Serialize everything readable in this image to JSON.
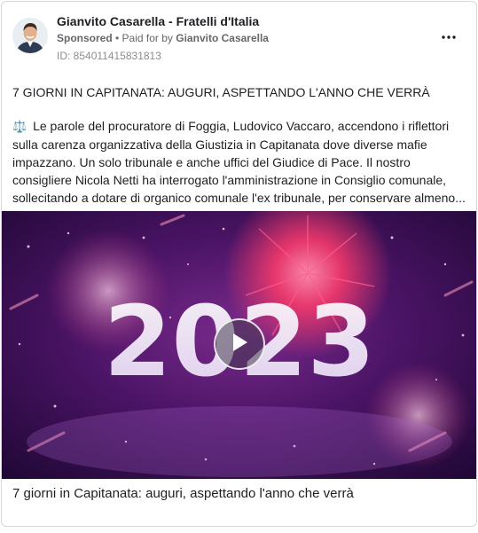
{
  "post": {
    "page_name": "Gianvito Casarella - Fratelli d'Italia",
    "sponsored_label": "Sponsored",
    "paid_for_prefix": "• Paid for by",
    "paid_for_name": "Gianvito Casarella",
    "ad_id": "ID: 854011415831813",
    "headline": "7 GIORNI IN CAPITANATA: AUGURI, ASPETTANDO L'ANNO CHE VERRÀ",
    "body_emoji": "⚖️",
    "body": "Le parole del procuratore di Foggia, Ludovico Vaccaro, accendono i riflettori sulla carenza organizzativa della Giustizia in Capitanata dove diverse mafie impazzano. Un solo tribunale e anche uffici del Giudice di Pace. Il nostro consigliere Nicola Netti ha interrogato l'amministrazione in Consiglio comunale, sollecitando a dotare di organico comunale l'ex tribunale, per conservare almeno...",
    "media_year": "2023",
    "caption": "7 giorni in Capitanata: auguri, aspettando l'anno che verrà"
  },
  "icons": {
    "more": "more-horizontal-icon",
    "play": "play-icon",
    "scales": "scales-of-justice-icon"
  },
  "colors": {
    "media_bg": "#3a1150",
    "firework": "#ff3b6b",
    "secondary_text": "#65676b"
  }
}
